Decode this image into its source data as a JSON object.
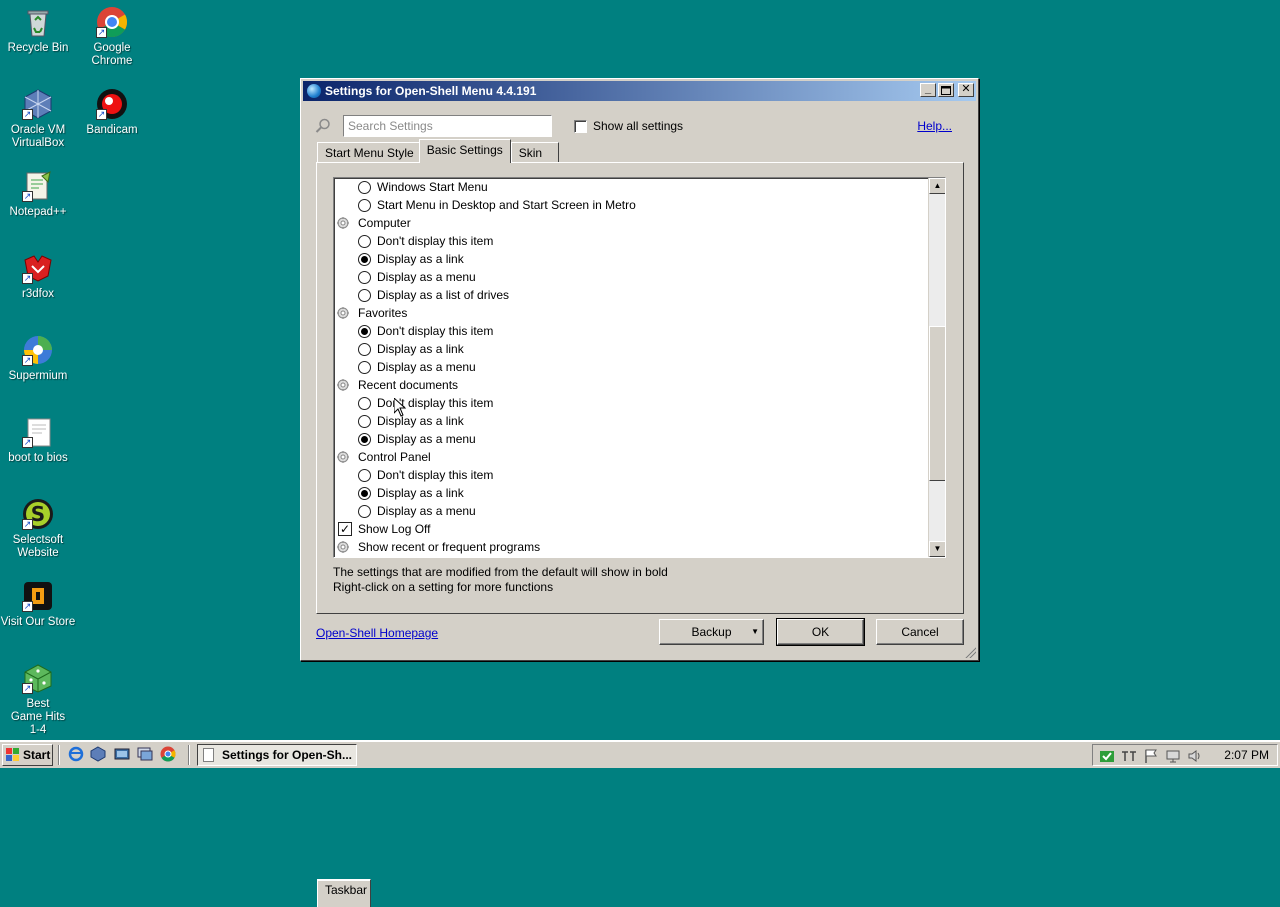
{
  "desktop": {
    "icons": [
      {
        "label": "Recycle Bin"
      },
      {
        "label": "Google Chrome"
      },
      {
        "label": "Oracle VM VirtualBox"
      },
      {
        "label": "Bandicam"
      },
      {
        "label": "Notepad++"
      },
      {
        "label": "r3dfox"
      },
      {
        "label": "Supermium"
      },
      {
        "label": "boot to bios"
      },
      {
        "label": "Selectsoft Website"
      },
      {
        "label": "Visit Our Store"
      },
      {
        "label": "Best Game Hits 1-4"
      }
    ]
  },
  "window": {
    "title": "Settings for Open-Shell Menu 4.4.191",
    "search": {
      "placeholder": "Search Settings",
      "value": ""
    },
    "show_all_label": "Show all settings",
    "help_label": "Help...",
    "tabs": [
      {
        "label": "Start Menu Style"
      },
      {
        "label": "Basic Settings"
      },
      {
        "label": "Skin"
      },
      {
        "label": "Taskbar"
      }
    ],
    "active_tab": "Basic Settings",
    "tree": [
      {
        "kind": "option",
        "label": "Windows Start Menu",
        "selected": false
      },
      {
        "kind": "option",
        "label": "Start Menu in Desktop and Start Screen in Metro",
        "selected": false
      },
      {
        "kind": "group",
        "label": "Computer"
      },
      {
        "kind": "option",
        "label": "Don't display this item",
        "selected": false
      },
      {
        "kind": "option",
        "label": "Display as a link",
        "selected": true
      },
      {
        "kind": "option",
        "label": "Display as a menu",
        "selected": false
      },
      {
        "kind": "option",
        "label": "Display as a list of drives",
        "selected": false
      },
      {
        "kind": "group",
        "label": "Favorites"
      },
      {
        "kind": "option",
        "label": "Don't display this item",
        "selected": true
      },
      {
        "kind": "option",
        "label": "Display as a link",
        "selected": false
      },
      {
        "kind": "option",
        "label": "Display as a menu",
        "selected": false
      },
      {
        "kind": "group",
        "label": "Recent documents"
      },
      {
        "kind": "option",
        "label": "Don't display this item",
        "selected": false
      },
      {
        "kind": "option",
        "label": "Display as a link",
        "selected": false
      },
      {
        "kind": "option",
        "label": "Display as a menu",
        "selected": true
      },
      {
        "kind": "group",
        "label": "Control Panel"
      },
      {
        "kind": "option",
        "label": "Don't display this item",
        "selected": false
      },
      {
        "kind": "option",
        "label": "Display as a link",
        "selected": true
      },
      {
        "kind": "option",
        "label": "Display as a menu",
        "selected": false
      },
      {
        "kind": "check",
        "label": "Show Log Off",
        "checked": true
      },
      {
        "kind": "group",
        "label": "Show recent or frequent programs"
      }
    ],
    "info_line1": "The settings that are modified from the default will show in bold",
    "info_line2": "Right-click on a setting for more functions",
    "homepage_label": "Open-Shell Homepage",
    "backup_label": "Backup",
    "ok_label": "OK",
    "cancel_label": "Cancel"
  },
  "taskbar": {
    "start_label": "Start",
    "task_label": "Settings for Open-Sh...",
    "clock": "2:07 PM"
  },
  "colors": {
    "desktop": "#008080",
    "titlebar_start": "#0a246a",
    "titlebar_end": "#a6caf0",
    "link": "#0000cc"
  }
}
